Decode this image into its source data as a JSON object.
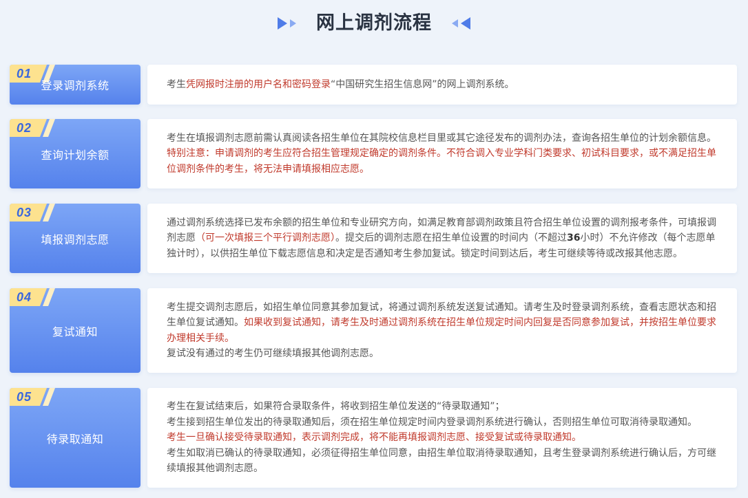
{
  "page": {
    "title": "网上调剂流程"
  },
  "icons": {
    "title_left": "double-arrow-right-icon",
    "title_right": "double-arrow-left-icon"
  },
  "colors": {
    "background": "#eef3fa",
    "card_gradient_top": "#7da6f6",
    "card_gradient_bottom": "#5582ec",
    "badge_yellow": "#fde28f",
    "badge_pale": "#fdefc4",
    "number_text": "#3a67dd",
    "body_text": "#555555",
    "highlight_text": "#c0392b",
    "title_text": "#2a3342"
  },
  "steps": [
    {
      "number": "01",
      "label": "登录调剂系统",
      "paragraphs": [
        [
          {
            "text": "考生"
          },
          {
            "text": "凭网报时注册的用户名和密码登录",
            "highlight": true
          },
          {
            "text": "“中国研究生招生信息网”的网上调剂系统。"
          }
        ]
      ]
    },
    {
      "number": "02",
      "label": "查询计划余额",
      "paragraphs": [
        [
          {
            "text": "考生在填报调剂志愿前需认真阅读各招生单位在其院校信息栏目里或其它途径发布的调剂办法，查询各招生单位的计划余额信息。"
          }
        ],
        [
          {
            "text": "特别注意：申请调剂的考生应符合招生管理规定确定的调剂条件。不符合调入专业学科门类要求、初试科目要求，或不满足招生单位调剂条件的考生，将无法申请填报相应志愿。",
            "highlight": true
          }
        ]
      ]
    },
    {
      "number": "03",
      "label": "填报调剂志愿",
      "paragraphs": [
        [
          {
            "text": "通过调剂系统选择已发布余额的招生单位和专业研究方向，如满足教育部调剂政策且符合招生单位设置的调剂报考条件，可填报调剂志愿"
          },
          {
            "text": "（可一次填报三个平行调剂志愿）",
            "highlight": true
          },
          {
            "text": "。提交后的调剂志愿在招生单位设置的时间内（不超过"
          },
          {
            "text": "36",
            "bold": true
          },
          {
            "text": "小时）不允许修改（每个志愿单独计时），以供招生单位下载志愿信息和决定是否通知考生参加复试。锁定时间到达后，考生可继续等待或改报其他志愿。"
          }
        ]
      ]
    },
    {
      "number": "04",
      "label": "复试通知",
      "paragraphs": [
        [
          {
            "text": "考生提交调剂志愿后，如招生单位同意其参加复试，将通过调剂系统发送复试通知。请考生及时登录调剂系统，查看志愿状态和招生单位复试通知。"
          },
          {
            "text": "如果收到复试通知，请考生及时通过调剂系统在招生单位规定时间内回复是否同意参加复试，并按招生单位要求办理相关手续。",
            "highlight": true
          }
        ],
        [
          {
            "text": "复试没有通过的考生仍可继续填报其他调剂志愿。"
          }
        ]
      ]
    },
    {
      "number": "05",
      "label": "待录取通知",
      "paragraphs": [
        [
          {
            "text": "考生在复试结束后，如果符合录取条件，将收到招生单位发送的“待录取通知”；"
          }
        ],
        [
          {
            "text": "考生接到招生单位发出的待录取通知后，须在招生单位规定时间内登录调剂系统进行确认，否则招生单位可取消待录取通知。"
          }
        ],
        [
          {
            "text": "考生一旦确认接受待录取通知，表示调剂完成，将不能再填报调剂志愿、接受复试或待录取通知。",
            "highlight": true
          }
        ],
        [
          {
            "text": "考生如取消已确认的待录取通知，必须征得招生单位同意，由招生单位取消待录取通知，且考生登录调剂系统进行确认后，方可继续填报其他调剂志愿。"
          }
        ]
      ]
    }
  ]
}
